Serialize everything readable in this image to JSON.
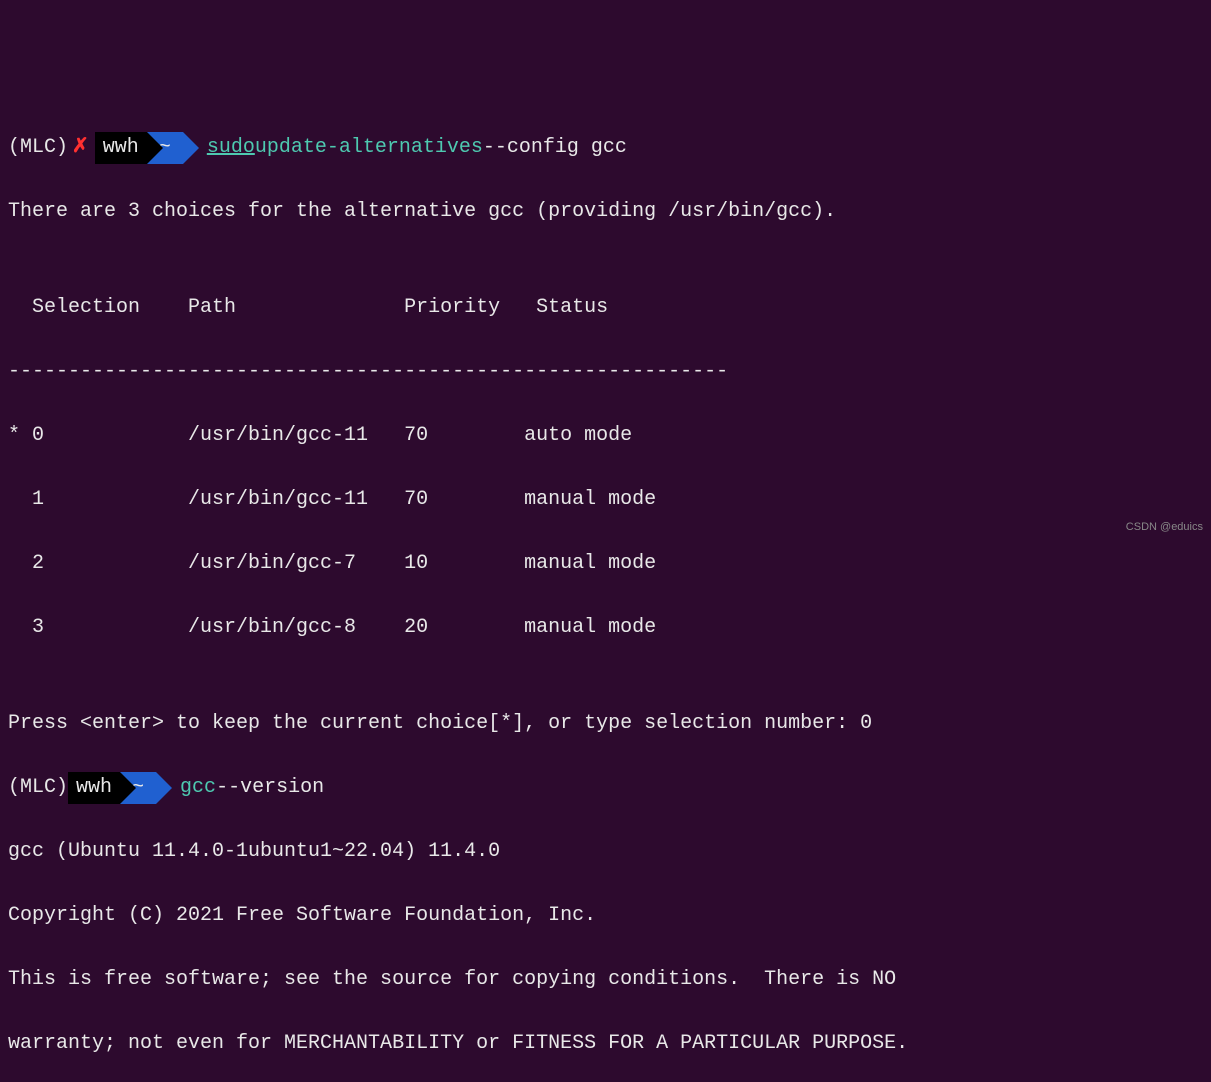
{
  "prompt1": {
    "env": "(MLC) ",
    "x": "✗",
    "user": "wwh",
    "tilde": "~",
    "sudo": "sudo",
    "cmd": "update-alternatives",
    "args": " --config gcc"
  },
  "out1": "There are 3 choices for the alternative gcc (providing /usr/bin/gcc).",
  "blank": "",
  "header": "  Selection    Path              Priority   Status",
  "divider": "------------------------------------------------------------",
  "row0": "* 0            /usr/bin/gcc-11   70        auto mode",
  "row1": "  1            /usr/bin/gcc-11   70        manual mode",
  "row2": "  2            /usr/bin/gcc-7    10        manual mode",
  "row3": "  3            /usr/bin/gcc-8    20        manual mode",
  "press": "Press <enter> to keep the current choice[*], or type selection number: 0",
  "prompt2": {
    "env": "(MLC) ",
    "user": "wwh",
    "tilde": "~",
    "cmd": "gcc",
    "args": " --version"
  },
  "ver1": "gcc (Ubuntu 11.4.0-1ubuntu1~22.04) 11.4.0",
  "ver2": "Copyright (C) 2021 Free Software Foundation, Inc.",
  "ver3": "This is free software; see the source for copying conditions.  There is NO",
  "ver4": "warranty; not even for MERCHANTABILITY or FITNESS FOR A PARTICULAR PURPOSE.",
  "watermark": "CSDN @eduics"
}
